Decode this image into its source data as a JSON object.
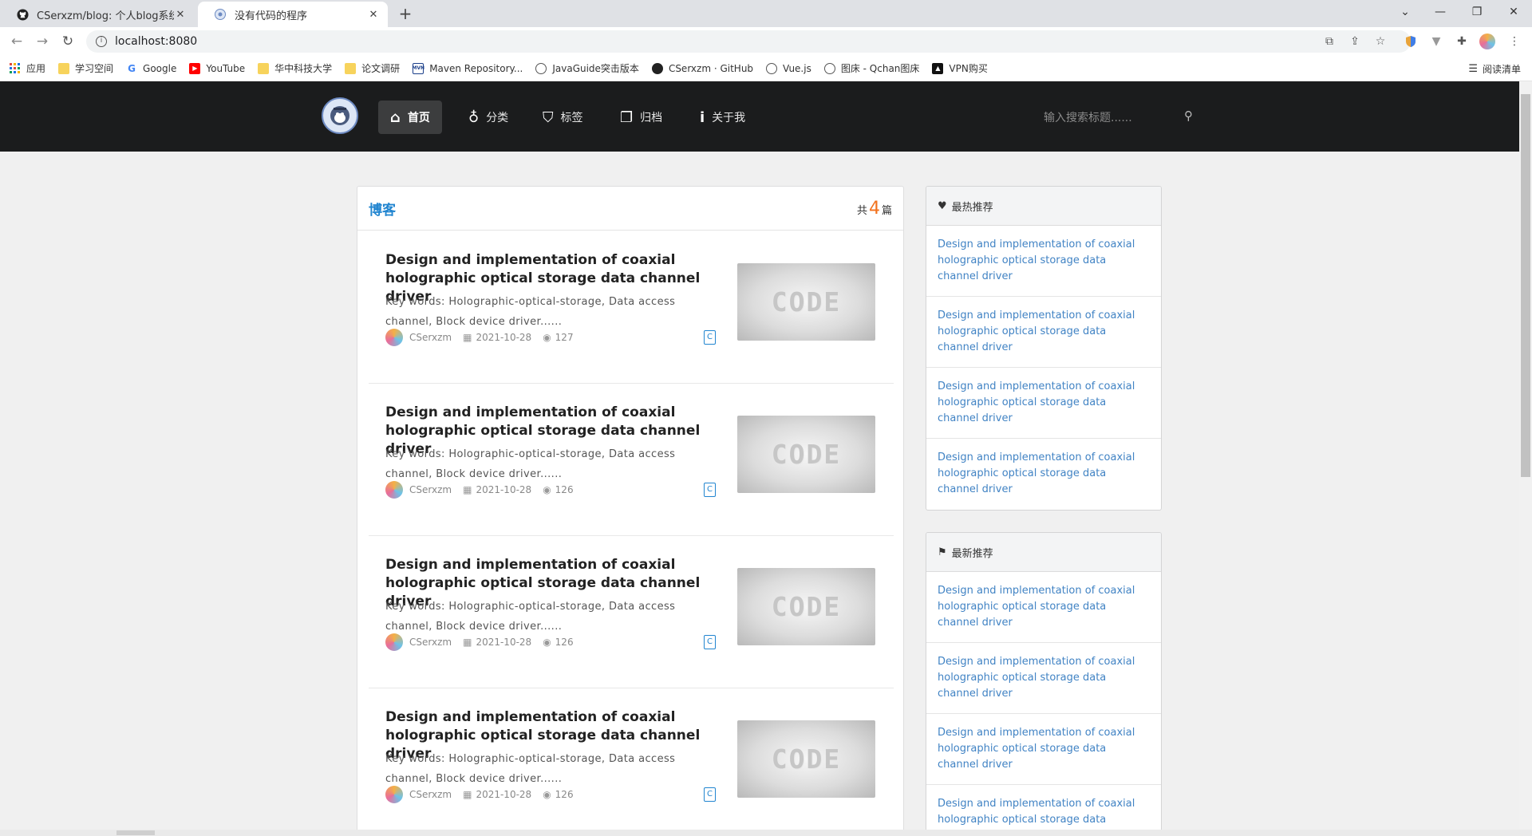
{
  "browser": {
    "tabs": [
      {
        "title": "CSerxzm/blog: 个人blog系统",
        "active": false
      },
      {
        "title": "没有代码的程序",
        "active": true
      }
    ],
    "new_tab": "+",
    "url": "localhost:8080",
    "bookmarks": [
      {
        "label": "应用",
        "icon": "apps-icon"
      },
      {
        "label": "学习空间",
        "icon": "folder-icon"
      },
      {
        "label": "Google",
        "icon": "google-icon"
      },
      {
        "label": "YouTube",
        "icon": "youtube-icon"
      },
      {
        "label": "华中科技大学",
        "icon": "folder-icon"
      },
      {
        "label": "论文调研",
        "icon": "folder-icon"
      },
      {
        "label": "Maven Repository...",
        "icon": "maven-icon"
      },
      {
        "label": "JavaGuide突击版本",
        "icon": "globe-icon"
      },
      {
        "label": "CSerxzm · GitHub",
        "icon": "github-icon"
      },
      {
        "label": "Vue.js",
        "icon": "globe-icon"
      },
      {
        "label": "图床 - Qchan图床",
        "icon": "globe-icon"
      },
      {
        "label": "VPN购买",
        "icon": "vpn-icon"
      }
    ],
    "reading_list": "阅读清单"
  },
  "site": {
    "nav": [
      {
        "label": "首页",
        "icon": "home-icon",
        "active": true
      },
      {
        "label": "分类",
        "icon": "lightbulb-icon",
        "active": false
      },
      {
        "label": "标签",
        "icon": "tags-icon",
        "active": false
      },
      {
        "label": "归档",
        "icon": "clone-icon",
        "active": false
      },
      {
        "label": "关于我",
        "icon": "info-icon",
        "active": false
      }
    ],
    "search_placeholder": "输入搜索标题......"
  },
  "blog": {
    "title": "博客",
    "count_prefix": "共",
    "count": "4",
    "count_suffix": "篇",
    "posts": [
      {
        "title": "Design and implementation of coaxial holographic optical storage data channel driver",
        "desc": "Key words: Holographic-optical-storage, Data access channel, Block device driver......",
        "author": "CSerxzm",
        "date": "2021-10-28",
        "views": "127",
        "tag": "C",
        "thumb_text": "CODE"
      },
      {
        "title": "Design and implementation of coaxial holographic optical storage data channel driver",
        "desc": "Key words: Holographic-optical-storage, Data access channel, Block device driver......",
        "author": "CSerxzm",
        "date": "2021-10-28",
        "views": "126",
        "tag": "C",
        "thumb_text": "CODE"
      },
      {
        "title": "Design and implementation of coaxial holographic optical storage data channel driver",
        "desc": "Key words: Holographic-optical-storage, Data access channel, Block device driver......",
        "author": "CSerxzm",
        "date": "2021-10-28",
        "views": "126",
        "tag": "C",
        "thumb_text": "CODE"
      },
      {
        "title": "Design and implementation of coaxial holographic optical storage data channel driver",
        "desc": "Key words: Holographic-optical-storage, Data access channel, Block device driver......",
        "author": "CSerxzm",
        "date": "2021-10-28",
        "views": "126",
        "tag": "C",
        "thumb_text": "CODE"
      }
    ]
  },
  "sidebar": {
    "hot": {
      "title": "最热推荐",
      "icon": "heart-icon",
      "items": [
        "Design and implementation of coaxial holographic optical storage data channel driver",
        "Design and implementation of coaxial holographic optical storage data channel driver",
        "Design and implementation of coaxial holographic optical storage data channel driver",
        "Design and implementation of coaxial holographic optical storage data channel driver"
      ]
    },
    "latest": {
      "title": "最新推荐",
      "icon": "bookmark-icon",
      "items": [
        "Design and implementation of coaxial holographic optical storage data channel driver",
        "Design and implementation of coaxial holographic optical storage data channel driver",
        "Design and implementation of coaxial holographic optical storage data channel driver",
        "Design and implementation of coaxial holographic optical storage data channel driver"
      ]
    }
  },
  "colors": {
    "navbar_bg": "#1b1c1d",
    "link": "#4183c4",
    "accent_blue": "#2185d0",
    "count_orange": "#f2711c"
  }
}
